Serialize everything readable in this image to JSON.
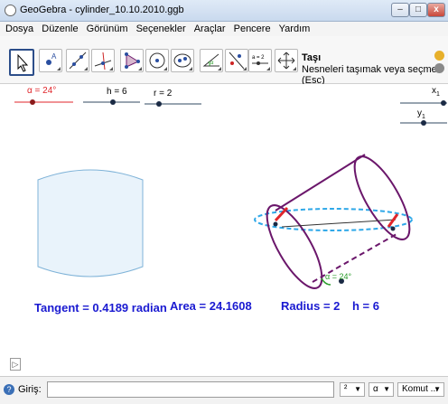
{
  "window": {
    "title": "GeoGebra - cylinder_10.10.2010.ggb",
    "minimize": "–",
    "maximize": "□",
    "close": "x"
  },
  "menu": [
    "Dosya",
    "Düzenle",
    "Görünüm",
    "Seçenekler",
    "Araçlar",
    "Pencere",
    "Yardım"
  ],
  "toolbar": {
    "tools": [
      "move-tool",
      "point-tool",
      "line-tool",
      "perpendicular-line-tool",
      "polygon-tool",
      "circle-tool",
      "conic-tool",
      "angle-tool",
      "reflect-tool",
      "slider-tool",
      "move-graphics-tool"
    ],
    "slider_tool_label": "a = 2",
    "active_title": "Taşı",
    "active_description": "Nesneleri taşımak veya seçmek (Esc)"
  },
  "sliders": {
    "alpha_label": "α = 24°",
    "h_label": "h = 6",
    "r_label": "r = 2",
    "x1_label": "x",
    "x1_sub": "1",
    "y1_label": "y",
    "y1_sub": "1"
  },
  "graphics": {
    "tangent_text": "Tangent = 0.4189  radian",
    "area_text": "Area = 24.1608",
    "radius_text": "Radius =  2",
    "h_text": "h  =  6",
    "angle_label": "α = 24°"
  },
  "input": {
    "help": "?",
    "label": "Giriş:",
    "value": "",
    "caret_symbol": "²",
    "alpha_symbol": "α",
    "command_placeholder": "Komut ..."
  },
  "colors": {
    "cylinder": "#6b176b",
    "ellipse_dash": "#2fa8e8",
    "radius_red": "#e0262b",
    "text_blue": "#1a1ad1"
  }
}
